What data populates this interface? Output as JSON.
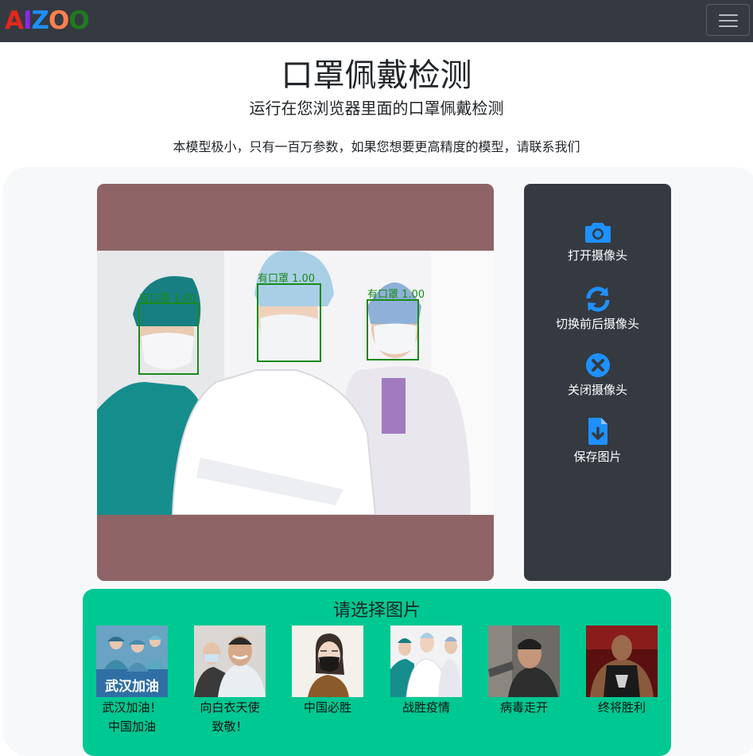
{
  "navbar": {
    "brand_letters": [
      {
        "char": "A",
        "color": "#e0281f"
      },
      {
        "char": "I",
        "color": "#8a2be2"
      },
      {
        "char": "Z",
        "color": "#1e90ff"
      },
      {
        "char": "O",
        "color": "#ff7f50"
      },
      {
        "char": "O",
        "color": "#1f7a1f"
      }
    ],
    "menu_icon": "hamburger-icon"
  },
  "header": {
    "title": "口罩佩戴检测",
    "subtitle": "运行在您浏览器里面的口罩佩戴检测",
    "description": "本模型极小，只有一百万参数，如果您想要更高精度的模型，请联系我们"
  },
  "detection": {
    "boxes": [
      {
        "label": "有口罩 1.00"
      },
      {
        "label": "有口罩 1.00"
      },
      {
        "label": "有口罩 1.00"
      }
    ],
    "box_color": "#1a8a1a",
    "canvas_color": "#8e6466"
  },
  "controls": {
    "accent": "#1e90ff",
    "items": [
      {
        "label": "打开摄像头",
        "icon": "camera-icon"
      },
      {
        "label": "切换前后摄像头",
        "icon": "sync-icon"
      },
      {
        "label": "关闭摄像头",
        "icon": "close-circle-icon"
      },
      {
        "label": "保存图片",
        "icon": "file-download-icon"
      }
    ]
  },
  "gallery": {
    "title": "请选择图片",
    "bg_color": "#00c892",
    "items": [
      {
        "caption_line1": "武汉加油！",
        "caption_line2": "中国加油",
        "overlay_text": "武汉加油"
      },
      {
        "caption_line1": "向白衣天使",
        "caption_line2": "致敬！"
      },
      {
        "caption_line1": "中国必胜"
      },
      {
        "caption_line1": "战胜疫情"
      },
      {
        "caption_line1": "病毒走开"
      },
      {
        "caption_line1": "终将胜利"
      }
    ]
  }
}
